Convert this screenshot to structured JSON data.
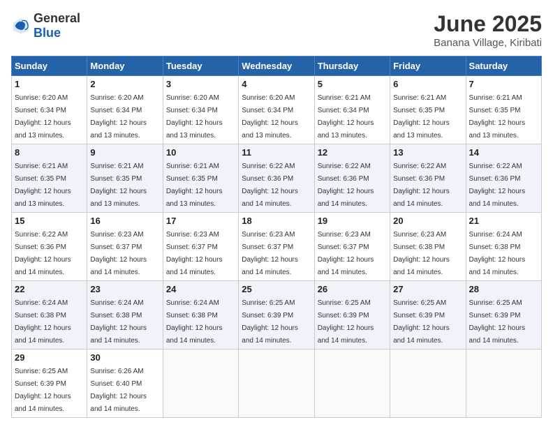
{
  "header": {
    "logo_general": "General",
    "logo_blue": "Blue",
    "title": "June 2025",
    "subtitle": "Banana Village, Kiribati"
  },
  "calendar": {
    "days_of_week": [
      "Sunday",
      "Monday",
      "Tuesday",
      "Wednesday",
      "Thursday",
      "Friday",
      "Saturday"
    ],
    "weeks": [
      [
        {
          "day": "",
          "info": ""
        },
        {
          "day": "2",
          "info": "Sunrise: 6:20 AM\nSunset: 6:34 PM\nDaylight: 12 hours\nand 13 minutes."
        },
        {
          "day": "3",
          "info": "Sunrise: 6:20 AM\nSunset: 6:34 PM\nDaylight: 12 hours\nand 13 minutes."
        },
        {
          "day": "4",
          "info": "Sunrise: 6:20 AM\nSunset: 6:34 PM\nDaylight: 12 hours\nand 13 minutes."
        },
        {
          "day": "5",
          "info": "Sunrise: 6:21 AM\nSunset: 6:34 PM\nDaylight: 12 hours\nand 13 minutes."
        },
        {
          "day": "6",
          "info": "Sunrise: 6:21 AM\nSunset: 6:35 PM\nDaylight: 12 hours\nand 13 minutes."
        },
        {
          "day": "7",
          "info": "Sunrise: 6:21 AM\nSunset: 6:35 PM\nDaylight: 12 hours\nand 13 minutes."
        }
      ],
      [
        {
          "day": "1",
          "info": "Sunrise: 6:20 AM\nSunset: 6:34 PM\nDaylight: 12 hours\nand 13 minutes."
        },
        {
          "day": "9",
          "info": "Sunrise: 6:21 AM\nSunset: 6:35 PM\nDaylight: 12 hours\nand 13 minutes."
        },
        {
          "day": "10",
          "info": "Sunrise: 6:21 AM\nSunset: 6:35 PM\nDaylight: 12 hours\nand 13 minutes."
        },
        {
          "day": "11",
          "info": "Sunrise: 6:22 AM\nSunset: 6:36 PM\nDaylight: 12 hours\nand 14 minutes."
        },
        {
          "day": "12",
          "info": "Sunrise: 6:22 AM\nSunset: 6:36 PM\nDaylight: 12 hours\nand 14 minutes."
        },
        {
          "day": "13",
          "info": "Sunrise: 6:22 AM\nSunset: 6:36 PM\nDaylight: 12 hours\nand 14 minutes."
        },
        {
          "day": "14",
          "info": "Sunrise: 6:22 AM\nSunset: 6:36 PM\nDaylight: 12 hours\nand 14 minutes."
        }
      ],
      [
        {
          "day": "8",
          "info": "Sunrise: 6:21 AM\nSunset: 6:35 PM\nDaylight: 12 hours\nand 13 minutes."
        },
        {
          "day": "16",
          "info": "Sunrise: 6:23 AM\nSunset: 6:37 PM\nDaylight: 12 hours\nand 14 minutes."
        },
        {
          "day": "17",
          "info": "Sunrise: 6:23 AM\nSunset: 6:37 PM\nDaylight: 12 hours\nand 14 minutes."
        },
        {
          "day": "18",
          "info": "Sunrise: 6:23 AM\nSunset: 6:37 PM\nDaylight: 12 hours\nand 14 minutes."
        },
        {
          "day": "19",
          "info": "Sunrise: 6:23 AM\nSunset: 6:37 PM\nDaylight: 12 hours\nand 14 minutes."
        },
        {
          "day": "20",
          "info": "Sunrise: 6:23 AM\nSunset: 6:38 PM\nDaylight: 12 hours\nand 14 minutes."
        },
        {
          "day": "21",
          "info": "Sunrise: 6:24 AM\nSunset: 6:38 PM\nDaylight: 12 hours\nand 14 minutes."
        }
      ],
      [
        {
          "day": "15",
          "info": "Sunrise: 6:22 AM\nSunset: 6:36 PM\nDaylight: 12 hours\nand 14 minutes."
        },
        {
          "day": "23",
          "info": "Sunrise: 6:24 AM\nSunset: 6:38 PM\nDaylight: 12 hours\nand 14 minutes."
        },
        {
          "day": "24",
          "info": "Sunrise: 6:24 AM\nSunset: 6:38 PM\nDaylight: 12 hours\nand 14 minutes."
        },
        {
          "day": "25",
          "info": "Sunrise: 6:25 AM\nSunset: 6:39 PM\nDaylight: 12 hours\nand 14 minutes."
        },
        {
          "day": "26",
          "info": "Sunrise: 6:25 AM\nSunset: 6:39 PM\nDaylight: 12 hours\nand 14 minutes."
        },
        {
          "day": "27",
          "info": "Sunrise: 6:25 AM\nSunset: 6:39 PM\nDaylight: 12 hours\nand 14 minutes."
        },
        {
          "day": "28",
          "info": "Sunrise: 6:25 AM\nSunset: 6:39 PM\nDaylight: 12 hours\nand 14 minutes."
        }
      ],
      [
        {
          "day": "22",
          "info": "Sunrise: 6:24 AM\nSunset: 6:38 PM\nDaylight: 12 hours\nand 14 minutes."
        },
        {
          "day": "30",
          "info": "Sunrise: 6:26 AM\nSunset: 6:40 PM\nDaylight: 12 hours\nand 14 minutes."
        },
        {
          "day": "",
          "info": ""
        },
        {
          "day": "",
          "info": ""
        },
        {
          "day": "",
          "info": ""
        },
        {
          "day": "",
          "info": ""
        },
        {
          "day": "",
          "info": ""
        }
      ],
      [
        {
          "day": "29",
          "info": "Sunrise: 6:25 AM\nSunset: 6:39 PM\nDaylight: 12 hours\nand 14 minutes."
        },
        {
          "day": "",
          "info": ""
        },
        {
          "day": "",
          "info": ""
        },
        {
          "day": "",
          "info": ""
        },
        {
          "day": "",
          "info": ""
        },
        {
          "day": "",
          "info": ""
        },
        {
          "day": "",
          "info": ""
        }
      ]
    ]
  }
}
